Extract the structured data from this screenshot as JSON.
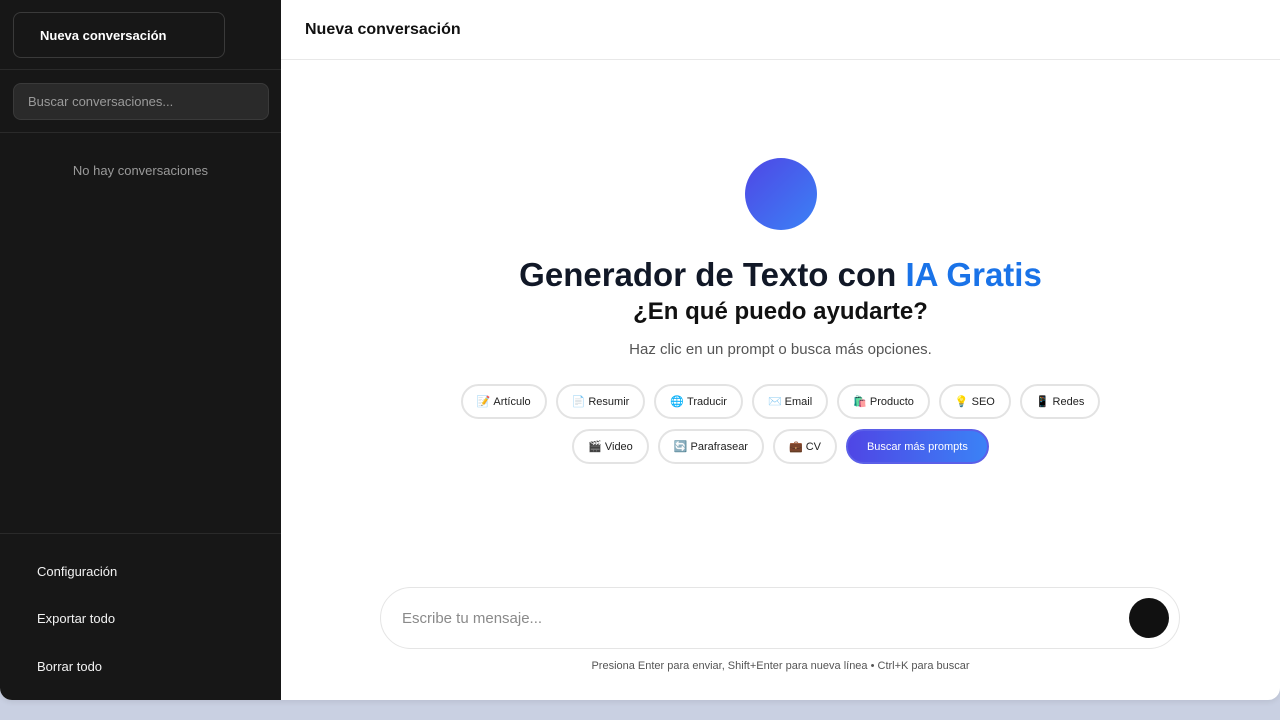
{
  "sidebar": {
    "new_chat_label": "Nueva conversación",
    "search_placeholder": "Buscar conversaciones...",
    "empty_message": "No hay conversaciones",
    "actions": [
      {
        "label": "Configuración"
      },
      {
        "label": "Exportar todo"
      },
      {
        "label": "Borrar todo"
      }
    ]
  },
  "header": {
    "title": "Nueva conversación"
  },
  "hero": {
    "title_main": "Generador de Texto con ",
    "title_accent": "IA Gratis",
    "subtitle": "¿En qué puedo ayudarte?",
    "hint": "Haz clic en un prompt o busca más opciones."
  },
  "chips": [
    {
      "emoji": "📝",
      "label": "Artículo"
    },
    {
      "emoji": "📄",
      "label": "Resumir"
    },
    {
      "emoji": "🌐",
      "label": "Traducir"
    },
    {
      "emoji": "✉️",
      "label": "Email"
    },
    {
      "emoji": "🛍️",
      "label": "Producto"
    },
    {
      "emoji": "💡",
      "label": "SEO"
    },
    {
      "emoji": "📱",
      "label": "Redes"
    },
    {
      "emoji": "🎬",
      "label": "Video"
    },
    {
      "emoji": "🔄",
      "label": "Parafrasear"
    },
    {
      "emoji": "💼",
      "label": "CV"
    }
  ],
  "more_prompts_label": "Buscar más prompts",
  "composer": {
    "placeholder": "Escribe tu mensaje...",
    "hint": "Presiona Enter para enviar, Shift+Enter para nueva línea • Ctrl+K para buscar"
  },
  "colors": {
    "sidebar_bg": "#171717",
    "accent": "#1a73e8",
    "gradient_start": "#4f46e5",
    "gradient_end": "#3b82f6"
  }
}
